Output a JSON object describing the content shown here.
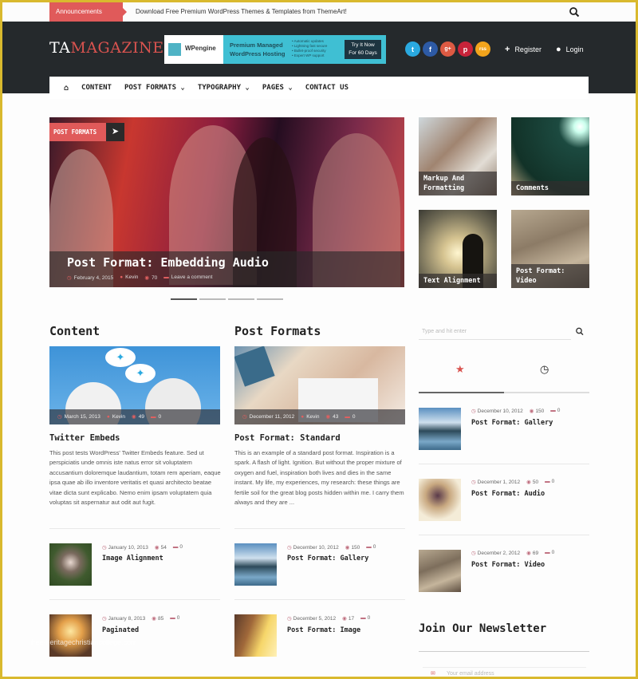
{
  "topbar": {
    "announcement_label": "Announcements",
    "ticker_text": "Download Free Premium WordPress Themes & Templates from ThemeArt!",
    "search_icon": "search-icon"
  },
  "header": {
    "logo_prefix": "TA",
    "logo_suffix": "MAGAZINE",
    "ad": {
      "brand": "WPengine",
      "headline_line1": "Premium Managed",
      "headline_line2": "WordPress Hosting",
      "bullets": [
        "Automatic updates",
        "Lightning fast secure",
        "Bullet-proof security",
        "Expert WP support"
      ],
      "cta_line1": "Try It Now",
      "cta_line2": "For 60 Days"
    },
    "social": [
      {
        "name": "twitter",
        "glyph": "t",
        "color": "#2aa9e0"
      },
      {
        "name": "facebook",
        "glyph": "f",
        "color": "#2d5aa5"
      },
      {
        "name": "google-plus",
        "glyph": "g+",
        "color": "#dd5a43"
      },
      {
        "name": "pinterest",
        "glyph": "p",
        "color": "#c8233a"
      },
      {
        "name": "rss",
        "glyph": "rss",
        "color": "#f2a41c"
      }
    ],
    "register_label": "Register",
    "login_label": "Login"
  },
  "nav": {
    "items": [
      {
        "label": "CONTENT",
        "dropdown": false
      },
      {
        "label": "POST FORMATS ⌄",
        "dropdown": true
      },
      {
        "label": "TYPOGRAPHY ⌄",
        "dropdown": true
      },
      {
        "label": "PAGES ⌄",
        "dropdown": true
      },
      {
        "label": "CONTACT US",
        "dropdown": false
      }
    ]
  },
  "hero": {
    "tag": "POST FORMATS",
    "title": "Post Format: Embedding Audio",
    "date": "February 4, 2015",
    "author": "Kevin",
    "views": "70",
    "comments": "Leave a comment",
    "slides": 4,
    "active_slide": 1
  },
  "tiles": [
    {
      "title": "Markup And Formatting"
    },
    {
      "title": "Comments"
    },
    {
      "title": "Text Alignment"
    },
    {
      "title": "Post Format: Video"
    }
  ],
  "sections": [
    {
      "title": "Content",
      "featured": {
        "date": "March 15, 2013",
        "author": "Kevin",
        "views": "49",
        "comments": "0",
        "title": "Twitter Embeds",
        "excerpt": "This post tests WordPress' Twitter Embeds feature. Sed ut perspiciatis unde omnis iste natus error sit voluptatem accusantium doloremque laudantium, totam rem aperiam, eaque ipsa quae ab illo inventore veritatis et quasi architecto beatae vitae dicta sunt explicabo. Nemo enim ipsam voluptatem quia voluptas sit aspernatur aut odit aut fugit."
      },
      "list": [
        {
          "date": "January 10, 2013",
          "views": "54",
          "comments": "0",
          "title": "Image Alignment"
        },
        {
          "date": "January 8, 2013",
          "views": "85",
          "comments": "0",
          "title": "Paginated"
        }
      ]
    },
    {
      "title": "Post Formats",
      "featured": {
        "date": "December 11, 2012",
        "author": "Kevin",
        "views": "43",
        "comments": "0",
        "title": "Post Format: Standard",
        "excerpt": "This is an example of a standard post format. Inspiration is a spark. A flash of light. Ignition. But without the proper mixture of oxygen and fuel, inspiration both lives and dies in the same instant. My life, my experiences, my research: these things are fertile soil for the great blog posts hidden within me. I carry them always and they are ..."
      },
      "list": [
        {
          "date": "December 10, 2012",
          "views": "150",
          "comments": "0",
          "title": "Post Format: Gallery"
        },
        {
          "date": "December 5, 2012",
          "views": "17",
          "comments": "0",
          "title": "Post Format: Image"
        }
      ]
    }
  ],
  "sidebar": {
    "search_placeholder": "Type and hit enter",
    "tabs": [
      {
        "icon": "star-icon",
        "active": true
      },
      {
        "icon": "clock-icon",
        "active": false
      }
    ],
    "posts": [
      {
        "date": "December 10, 2012",
        "views": "150",
        "comments": "0",
        "title": "Post Format: Gallery"
      },
      {
        "date": "December 1, 2012",
        "views": "50",
        "comments": "0",
        "title": "Post Format: Audio"
      },
      {
        "date": "December 2, 2012",
        "views": "69",
        "comments": "0",
        "title": "Post Format: Video"
      }
    ],
    "newsletter_title": "Join Our Newsletter",
    "newsletter_placeholder": "Your email address"
  },
  "watermark": "free-heritagechristiancollege.com"
}
